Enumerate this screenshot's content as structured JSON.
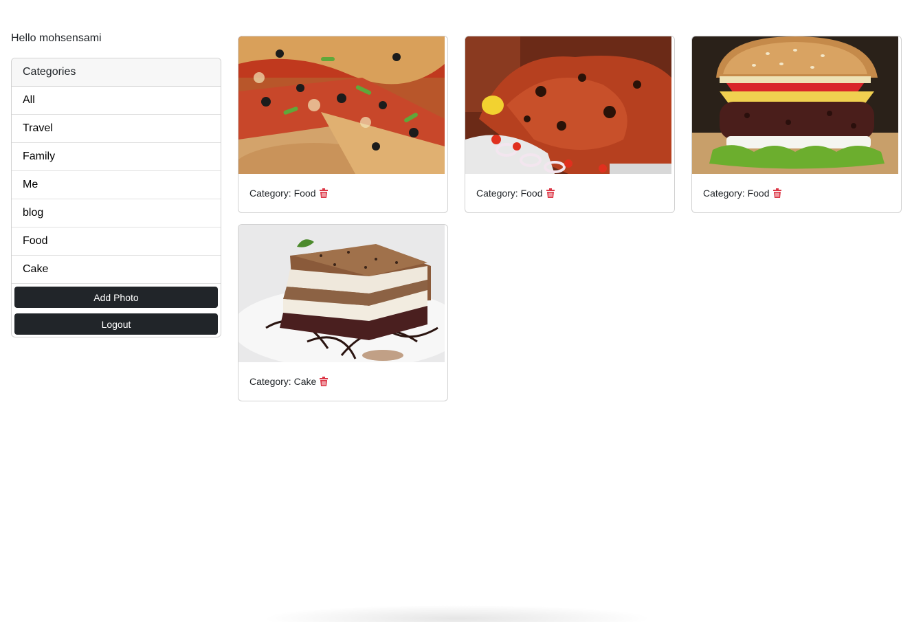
{
  "greeting": "Hello mohsensami",
  "sidebar": {
    "header": "Categories",
    "items": [
      {
        "label": "All"
      },
      {
        "label": "Travel"
      },
      {
        "label": "Family"
      },
      {
        "label": "Me"
      },
      {
        "label": "blog"
      },
      {
        "label": "Food"
      },
      {
        "label": "Cake"
      }
    ],
    "add_photo_label": "Add Photo",
    "logout_label": "Logout"
  },
  "photos": [
    {
      "category_text": "Category: Food",
      "image": "pizza-photo"
    },
    {
      "category_text": "Category: Food",
      "image": "grilled-chicken-photo"
    },
    {
      "category_text": "Category: Food",
      "image": "burger-photo"
    },
    {
      "category_text": "Category: Cake",
      "image": "cake-slice-photo"
    }
  ],
  "colors": {
    "button_bg": "#212529",
    "delete_icon": "#dc3545",
    "card_header_bg": "#f7f7f7"
  },
  "icons": {
    "delete": "trash-icon"
  }
}
